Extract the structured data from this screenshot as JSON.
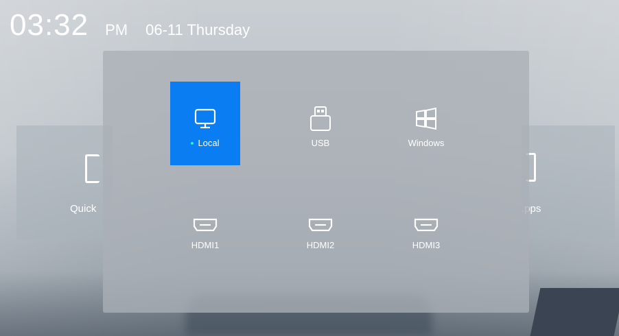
{
  "clock": {
    "time": "03:32",
    "ampm": "PM",
    "date": "06-11 Thursday"
  },
  "background_cards": {
    "left": {
      "label": "Quick"
    },
    "right": {
      "label": ".pps"
    }
  },
  "source_panel": {
    "sources": [
      {
        "label": "Local",
        "icon": "monitor-icon",
        "selected": true
      },
      {
        "label": "USB",
        "icon": "usb-icon",
        "selected": false
      },
      {
        "label": "Windows",
        "icon": "windows-icon",
        "selected": false
      },
      {
        "label": "HDMI1",
        "icon": "hdmi-icon",
        "selected": false
      },
      {
        "label": "HDMI2",
        "icon": "hdmi-icon",
        "selected": false
      },
      {
        "label": "HDMI3",
        "icon": "hdmi-icon",
        "selected": false
      }
    ]
  },
  "colors": {
    "accent": "#0a7df2",
    "indicator": "#2df0c4"
  }
}
